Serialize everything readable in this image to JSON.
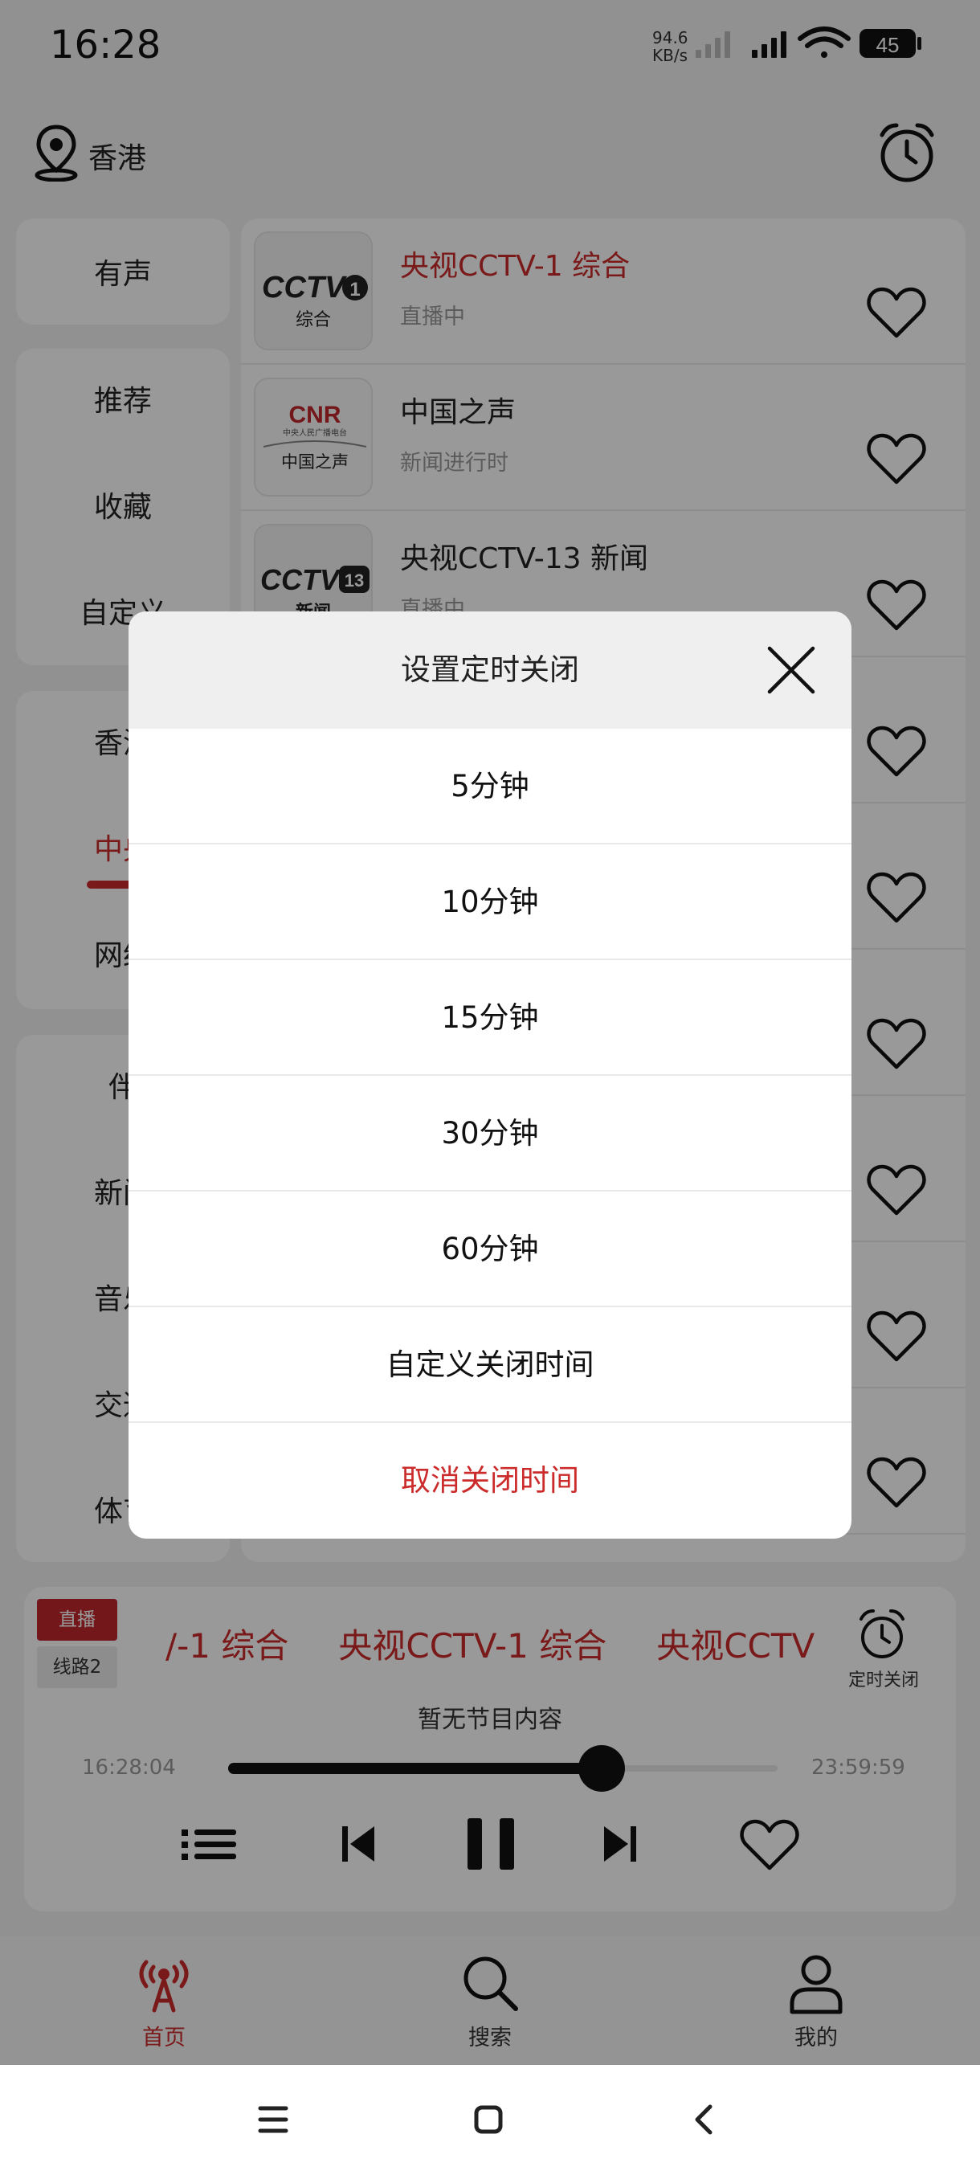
{
  "status": {
    "time": "16:28",
    "net_speed": "94.6",
    "net_unit": "KB/s",
    "battery": "45"
  },
  "header": {
    "location": "香港"
  },
  "categories": {
    "box1": [
      "有声"
    ],
    "box2": [
      "推荐",
      "收藏",
      "自定义"
    ],
    "box3": [
      "香港",
      "中央",
      "网络"
    ],
    "box4": [
      "伴",
      "新闻",
      "音乐",
      "交通",
      "体育"
    ]
  },
  "logos": {
    "cctv1": {
      "brand": "CCTV",
      "num": "1",
      "sub": "综合"
    },
    "cnr": {
      "brand": "CNR",
      "tiny": "中央人民广播电台",
      "sub": "中国之声"
    },
    "cctv13": {
      "brand": "CCTV",
      "num": "13",
      "sub": "新闻"
    }
  },
  "stations": [
    {
      "title": "央视CCTV-1 综合",
      "sub": "直播中"
    },
    {
      "title": "中国之声",
      "sub": "新闻进行时"
    },
    {
      "title": "央视CCTV-13 新闻",
      "sub": "直播中"
    }
  ],
  "player": {
    "live_badge": "直播",
    "line_badge": "线路2",
    "marquee": [
      "/-1 综合",
      "央视CCTV-1 综合",
      "央视CCTV"
    ],
    "timer_label": "定时关闭",
    "program": "暂无节目内容",
    "start_time": "16:28:04",
    "end_time": "23:59:59",
    "progress": 0.68
  },
  "nav": {
    "home": "首页",
    "search": "搜索",
    "mine": "我的"
  },
  "dialog": {
    "title": "设置定时关闭",
    "options": [
      "5分钟",
      "10分钟",
      "15分钟",
      "30分钟",
      "60分钟",
      "自定义关闭时间"
    ],
    "cancel": "取消关闭时间"
  },
  "colors": {
    "accent": "#cc2b2b",
    "badge_red": "#c0272d"
  }
}
